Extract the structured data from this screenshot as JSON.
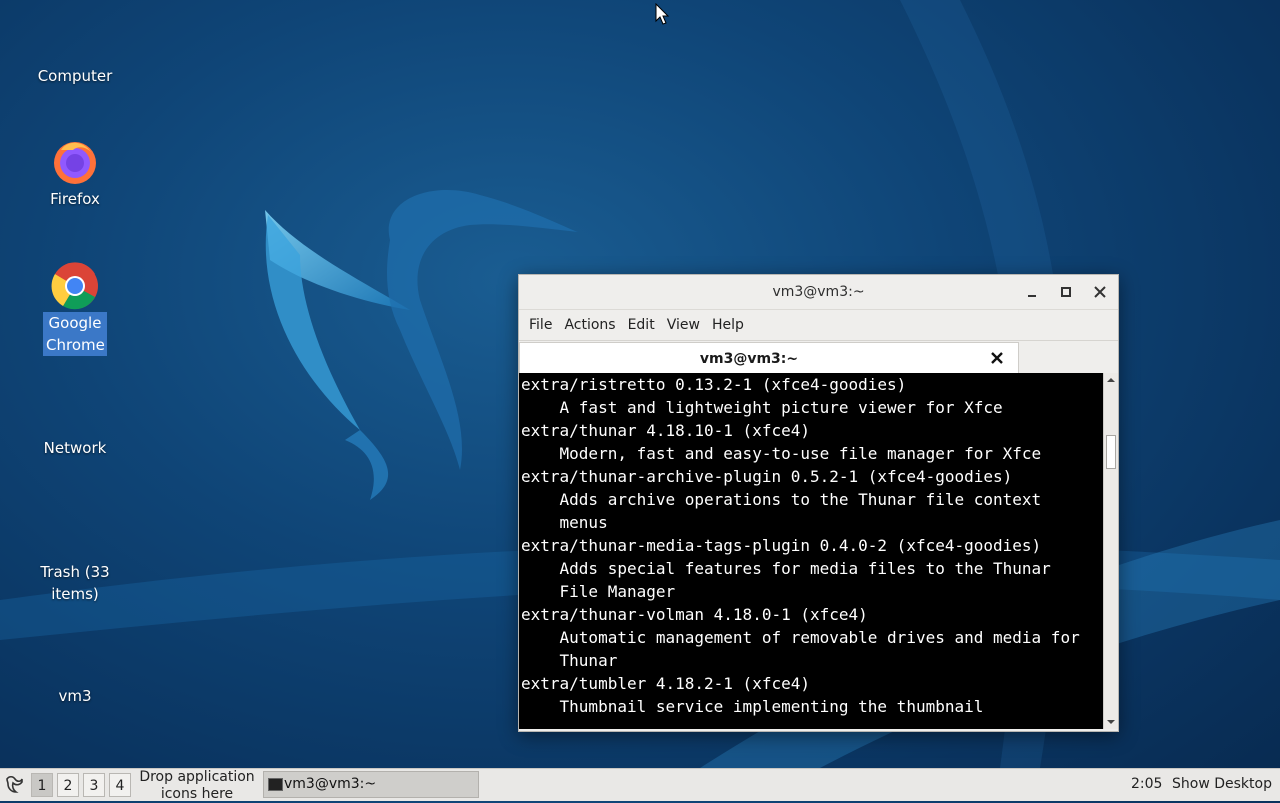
{
  "desktop": {
    "icons": [
      {
        "label": "Computer"
      },
      {
        "label": "Firefox"
      },
      {
        "label": "Google Chrome"
      },
      {
        "label": "Network"
      },
      {
        "label": "Trash (33 items)"
      },
      {
        "label": "vm3"
      }
    ]
  },
  "window": {
    "title": "vm3@vm3:~",
    "menu": [
      "File",
      "Actions",
      "Edit",
      "View",
      "Help"
    ],
    "tab_title": "vm3@vm3:~",
    "terminal_lines": [
      "extra/ristretto 0.13.2-1 (xfce4-goodies)",
      "    A fast and lightweight picture viewer for Xfce",
      "extra/thunar 4.18.10-1 (xfce4)",
      "    Modern, fast and easy-to-use file manager for Xfce",
      "extra/thunar-archive-plugin 0.5.2-1 (xfce4-goodies)",
      "    Adds archive operations to the Thunar file context",
      "    menus",
      "extra/thunar-media-tags-plugin 0.4.0-2 (xfce4-goodies)",
      "    Adds special features for media files to the Thunar",
      "    File Manager",
      "extra/thunar-volman 4.18.0-1 (xfce4)",
      "    Automatic management of removable drives and media for",
      "    Thunar",
      "extra/tumbler 4.18.2-1 (xfce4)",
      "    Thumbnail service implementing the thumbnail"
    ]
  },
  "taskbar": {
    "workspaces": [
      "1",
      "2",
      "3",
      "4"
    ],
    "active_workspace": "1",
    "drop_hint_line1": "Drop application",
    "drop_hint_line2": "icons here",
    "task_label": "vm3@vm3:~",
    "clock": "2:05",
    "show_desktop": "Show Desktop"
  },
  "colors": {
    "selection": "#3b78c7",
    "terminal_bg": "#000000",
    "terminal_fg": "#ffffff"
  }
}
